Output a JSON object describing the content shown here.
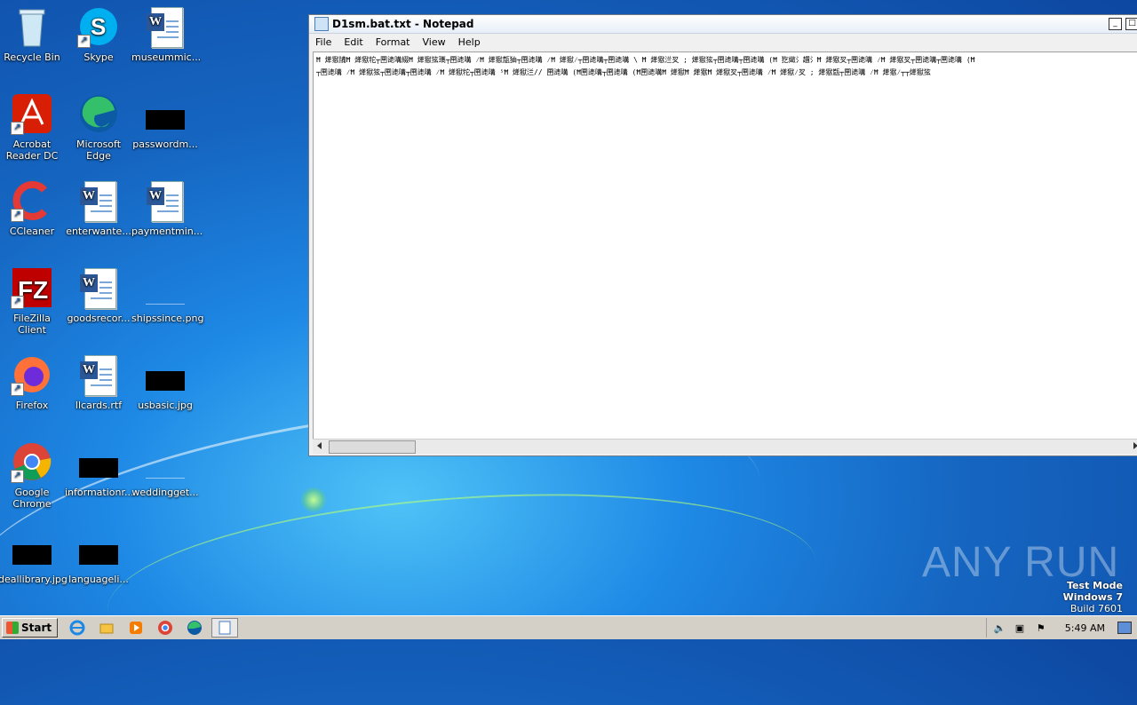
{
  "desktop": {
    "icons": [
      {
        "label": "Recycle Bin",
        "icon": "recycle-bin-icon"
      },
      {
        "label": "Skype",
        "icon": "skype-icon"
      },
      {
        "label": "museummic...",
        "icon": "word-doc-icon"
      },
      {
        "label": "Acrobat Reader DC",
        "icon": "acrobat-icon"
      },
      {
        "label": "Microsoft Edge",
        "icon": "edge-icon"
      },
      {
        "label": "passwordm...",
        "icon": "image-file-icon"
      },
      {
        "label": "CCleaner",
        "icon": "ccleaner-icon"
      },
      {
        "label": "enterwante...",
        "icon": "word-doc-icon"
      },
      {
        "label": "paymentmin...",
        "icon": "word-doc-icon"
      },
      {
        "label": "FileZilla Client",
        "icon": "filezilla-icon"
      },
      {
        "label": "goodsrecor...",
        "icon": "word-doc-icon"
      },
      {
        "label": "shipssince.png",
        "icon": "image-file-icon"
      },
      {
        "label": "Firefox",
        "icon": "firefox-icon"
      },
      {
        "label": "llcards.rtf",
        "icon": "word-doc-icon"
      },
      {
        "label": "usbasic.jpg",
        "icon": "image-file-icon"
      },
      {
        "label": "Google Chrome",
        "icon": "chrome-icon"
      },
      {
        "label": "informationr...",
        "icon": "image-file-icon"
      },
      {
        "label": "weddingget...",
        "icon": "image-file-icon"
      },
      {
        "label": "deallibrary.jpg",
        "icon": "image-file-icon"
      },
      {
        "label": "languageli...",
        "icon": "image-file-icon"
      }
    ]
  },
  "notepad": {
    "title": "D1sm.bat.txt - Notepad",
    "menu": [
      "File",
      "Edit",
      "Format",
      "View",
      "Help"
    ],
    "content_line1": "Ħ 㷣㺇㸢Ħ 㷣㺇㸰┬㘡㗟㗕綴Ħ 㷣㺇㹡㼇┬㘡㗟㗕 ⁄Ħ 㷣㺇㼹㹨┬㘡㗟㗕 ⁄Ħ 㷣㺇⁄┬㘡㗟㗕┬㘡㗟㗕 \\ Ħ 㷣㺇㳕㕚 ; 㷣㺇㹡┬㘡㗟㗕┬㘡㗟㗕 (Ħ 犵嬍氵趲氵Ħ 㷣㺇㕚┬㘡㗟㗕 ⁄Ħ 㷣㺇㕚┬㘡㗟㗕┬㘡㗟㗕 (Ħ",
    "content_line2": "┬㘡㗟㗕 ⁄Ħ 㷣㺇㹡┬㘡㗟㗕┬㘡㗟㗕 ⁄Ħ 㷣㺇㸰┬㘡㗟㗕 ⁵Ħ 㷣㺇㳕// 㘡㗟㗕 (Ħ㘡㗟㗕┬㘡㗟㗕 (Ħ㘡㗟㗕Ħ 㷣㺇Ħ 㷣㺇Ħ 㷣㺇㕚┬㘡㗟㗕 ⁄Ħ 㷣㺇⁄㕚 ; 㷣㺇㼹┬㘡㗟㗕 ⁄Ħ 㷣㺇⁄┬┬㷣㺇㹡"
  },
  "watermark": {
    "mode": "Test Mode",
    "os": "Windows 7",
    "build": "Build 7601",
    "brand": "ANY RUN"
  },
  "taskbar": {
    "start_label": "Start",
    "clock": "5:49 AM",
    "apps": [
      "ie-icon",
      "explorer-icon",
      "media-player-icon",
      "chrome-icon",
      "edge-icon",
      "notepad-icon"
    ]
  }
}
